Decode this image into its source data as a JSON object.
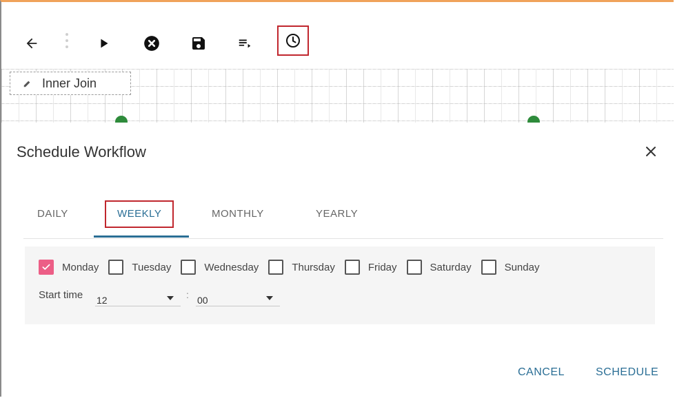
{
  "toolbar": {
    "buttons": [
      {
        "name": "back",
        "icon": "arrow-left-icon"
      },
      {
        "name": "run",
        "icon": "play-icon"
      },
      {
        "name": "stop",
        "icon": "close-circle-icon"
      },
      {
        "name": "save",
        "icon": "save-icon"
      },
      {
        "name": "logs",
        "icon": "playlist-icon"
      },
      {
        "name": "schedule",
        "icon": "clock-icon",
        "highlighted": true
      }
    ]
  },
  "canvas": {
    "node_label": "Inner Join",
    "connector_color": "#2e8b3b"
  },
  "dialog": {
    "title": "Schedule Workflow",
    "tabs": [
      {
        "label": "DAILY",
        "active": false
      },
      {
        "label": "WEEKLY",
        "active": true
      },
      {
        "label": "MONTHLY",
        "active": false
      },
      {
        "label": "YEARLY",
        "active": false
      }
    ],
    "days": [
      {
        "label": "Monday",
        "checked": true
      },
      {
        "label": "Tuesday",
        "checked": false
      },
      {
        "label": "Wednesday",
        "checked": false
      },
      {
        "label": "Thursday",
        "checked": false
      },
      {
        "label": "Friday",
        "checked": false
      },
      {
        "label": "Saturday",
        "checked": false
      },
      {
        "label": "Sunday",
        "checked": false
      }
    ],
    "start_time_label": "Start time",
    "hour": "12",
    "minute": "00",
    "colon": ":",
    "cancel_label": "CANCEL",
    "schedule_label": "SCHEDULE"
  },
  "colors": {
    "accent": "#2a6e95",
    "checkbox_checked": "#ec5e86",
    "highlight_box": "#c0262d",
    "top_border": "#f0a25a"
  }
}
